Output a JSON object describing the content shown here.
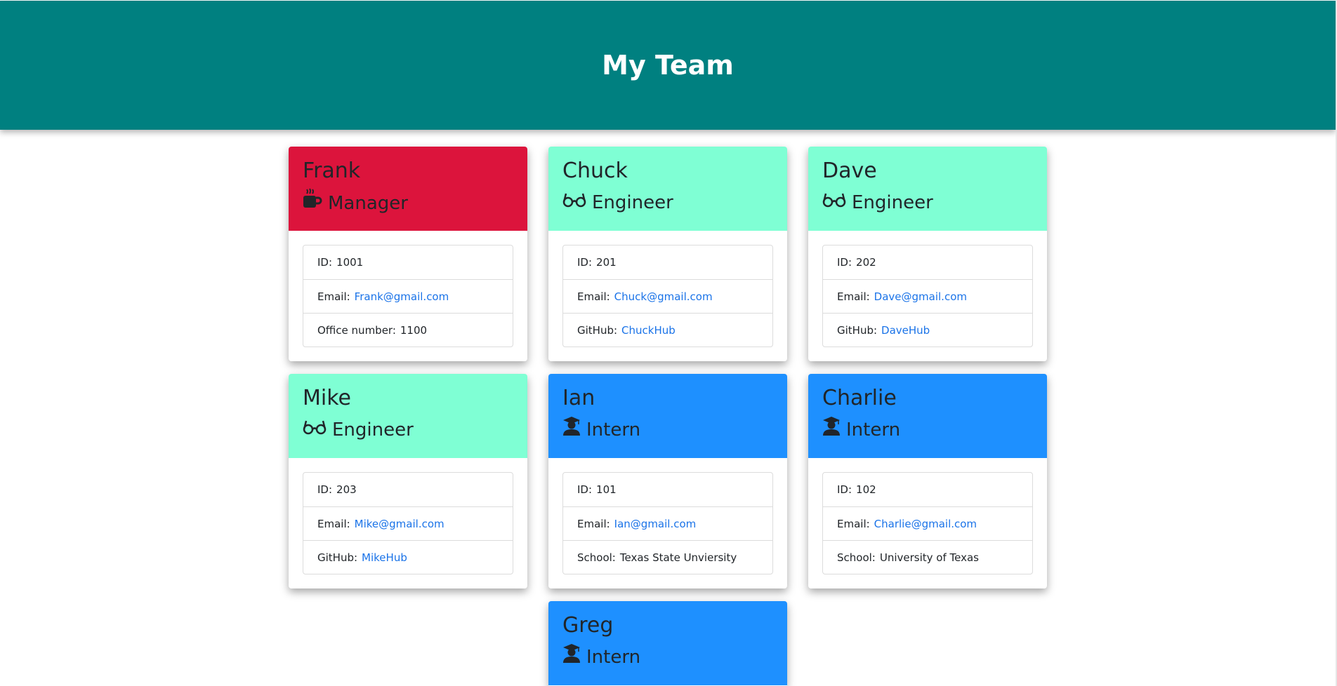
{
  "page": {
    "title": "My Team"
  },
  "colors": {
    "header": "#008080",
    "manager": "#dc143c",
    "engineer": "#7fffd4",
    "intern": "#1e90ff",
    "link": "#1a73e8"
  },
  "members": [
    {
      "name": "Frank",
      "role": "Manager",
      "icon": "coffee-icon",
      "id_label": "ID:",
      "id": "1001",
      "email_label": "Email:",
      "email": "Frank@gmail.com",
      "extra_label": "Office number:",
      "extra": "1100"
    },
    {
      "name": "Chuck",
      "role": "Engineer",
      "icon": "glasses-icon",
      "id_label": "ID:",
      "id": "201",
      "email_label": "Email:",
      "email": "Chuck@gmail.com",
      "extra_label": "GitHub:",
      "extra": "ChuckHub"
    },
    {
      "name": "Dave",
      "role": "Engineer",
      "icon": "glasses-icon",
      "id_label": "ID:",
      "id": "202",
      "email_label": "Email:",
      "email": "Dave@gmail.com",
      "extra_label": "GitHub:",
      "extra": "DaveHub"
    },
    {
      "name": "Mike",
      "role": "Engineer",
      "icon": "glasses-icon",
      "id_label": "ID:",
      "id": "203",
      "email_label": "Email:",
      "email": "Mike@gmail.com",
      "extra_label": "GitHub:",
      "extra": "MikeHub"
    },
    {
      "name": "Ian",
      "role": "Intern",
      "icon": "graduate-icon",
      "id_label": "ID:",
      "id": "101",
      "email_label": "Email:",
      "email": "Ian@gmail.com",
      "extra_label": "School:",
      "extra": "Texas State Unviersity"
    },
    {
      "name": "Charlie",
      "role": "Intern",
      "icon": "graduate-icon",
      "id_label": "ID:",
      "id": "102",
      "email_label": "Email:",
      "email": "Charlie@gmail.com",
      "extra_label": "School:",
      "extra": "University of Texas"
    },
    {
      "name": "Greg",
      "role": "Intern",
      "icon": "graduate-icon"
    }
  ]
}
